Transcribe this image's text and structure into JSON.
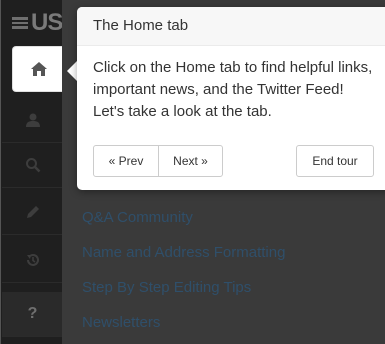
{
  "brand": {
    "logo_text": "US"
  },
  "sidebar": {
    "items": [
      {
        "icon": "home-icon"
      },
      {
        "icon": "user-icon"
      },
      {
        "icon": "search-icon"
      },
      {
        "icon": "pencil-icon"
      },
      {
        "icon": "history-icon"
      },
      {
        "icon": "help-icon",
        "glyph": "?"
      }
    ]
  },
  "main": {
    "links": [
      "Q&A Community",
      "Name and Address Formatting",
      "Step By Step Editing Tips",
      "Newsletters"
    ]
  },
  "tour": {
    "title": "The Home tab",
    "content": "Click on the Home tab to find helpful links, important news, and the Twitter Feed! Let's take a look at the tab.",
    "prev_label": "« Prev",
    "next_label": "Next »",
    "end_label": "End tour"
  },
  "colors": {
    "overlay": "#333333",
    "sidebar": "#1f1f1f",
    "popover_bg": "#ffffff",
    "popover_title_bg": "#f7f7f7"
  }
}
